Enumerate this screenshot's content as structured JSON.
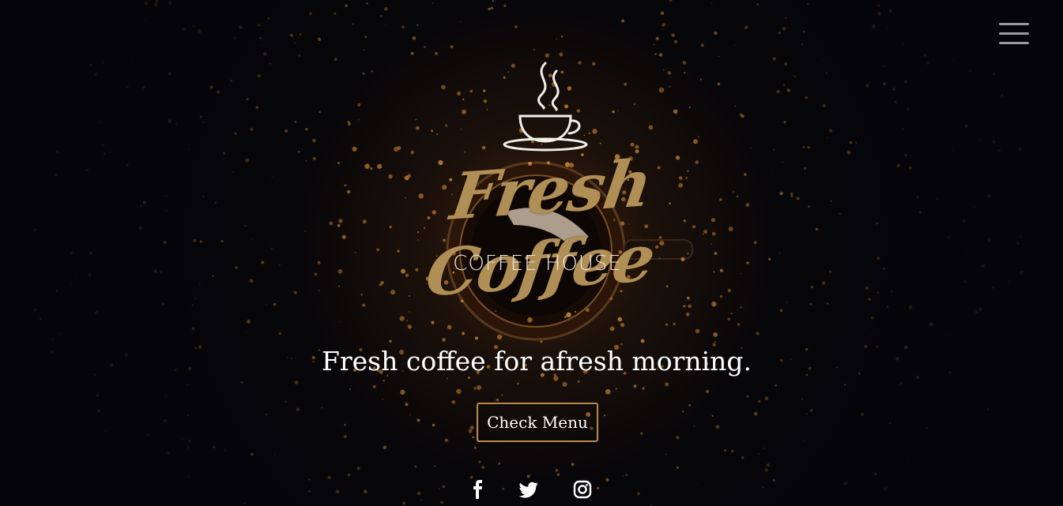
{
  "header": {
    "menu_icon": "hamburger-menu-icon"
  },
  "hero": {
    "logo_script": "Fresh Coffee",
    "logo_subtitle": "COFFEE HOUSE",
    "logo_icon": "coffee-cup-icon",
    "tagline": "Fresh coffee for afresh morning.",
    "cta_label": "Check Menu"
  },
  "social": [
    {
      "name": "facebook",
      "icon": "facebook-icon"
    },
    {
      "name": "twitter",
      "icon": "twitter-icon"
    },
    {
      "name": "instagram",
      "icon": "instagram-icon"
    }
  ],
  "colors": {
    "background": "#050509",
    "accent_gold": "#b08f57",
    "button_border": "#b98a4e",
    "text": "#ffffff",
    "menu_bars": "#9a9a9e"
  }
}
